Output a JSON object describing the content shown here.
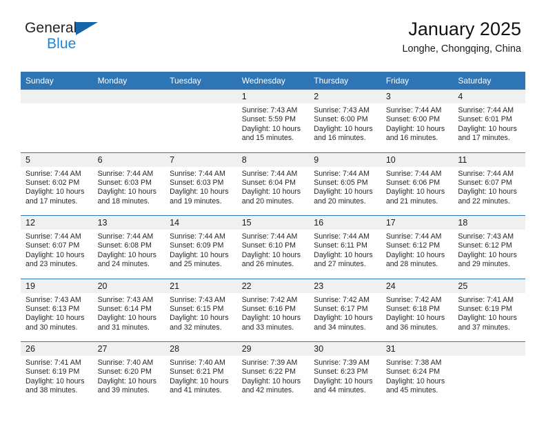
{
  "brand": {
    "line1": "General",
    "line2": "Blue",
    "triangle_color": "#1565a8",
    "blue_text_color": "#1a87d8"
  },
  "header": {
    "title": "January 2025",
    "subtitle": "Longhe, Chongqing, China"
  },
  "theme": {
    "header_blue": "#2e75b6",
    "daynum_band": "#f0f0f0",
    "cell_bg": "#ffffff",
    "text": "#262626"
  },
  "weekdays": [
    "Sunday",
    "Monday",
    "Tuesday",
    "Wednesday",
    "Thursday",
    "Friday",
    "Saturday"
  ],
  "weeks": [
    {
      "days": [
        {
          "num": "",
          "lines": []
        },
        {
          "num": "",
          "lines": []
        },
        {
          "num": "",
          "lines": []
        },
        {
          "num": "1",
          "lines": [
            "Sunrise: 7:43 AM",
            "Sunset: 5:59 PM",
            "Daylight: 10 hours",
            "and 15 minutes."
          ]
        },
        {
          "num": "2",
          "lines": [
            "Sunrise: 7:43 AM",
            "Sunset: 6:00 PM",
            "Daylight: 10 hours",
            "and 16 minutes."
          ]
        },
        {
          "num": "3",
          "lines": [
            "Sunrise: 7:44 AM",
            "Sunset: 6:00 PM",
            "Daylight: 10 hours",
            "and 16 minutes."
          ]
        },
        {
          "num": "4",
          "lines": [
            "Sunrise: 7:44 AM",
            "Sunset: 6:01 PM",
            "Daylight: 10 hours",
            "and 17 minutes."
          ]
        }
      ]
    },
    {
      "days": [
        {
          "num": "5",
          "lines": [
            "Sunrise: 7:44 AM",
            "Sunset: 6:02 PM",
            "Daylight: 10 hours",
            "and 17 minutes."
          ]
        },
        {
          "num": "6",
          "lines": [
            "Sunrise: 7:44 AM",
            "Sunset: 6:03 PM",
            "Daylight: 10 hours",
            "and 18 minutes."
          ]
        },
        {
          "num": "7",
          "lines": [
            "Sunrise: 7:44 AM",
            "Sunset: 6:03 PM",
            "Daylight: 10 hours",
            "and 19 minutes."
          ]
        },
        {
          "num": "8",
          "lines": [
            "Sunrise: 7:44 AM",
            "Sunset: 6:04 PM",
            "Daylight: 10 hours",
            "and 20 minutes."
          ]
        },
        {
          "num": "9",
          "lines": [
            "Sunrise: 7:44 AM",
            "Sunset: 6:05 PM",
            "Daylight: 10 hours",
            "and 20 minutes."
          ]
        },
        {
          "num": "10",
          "lines": [
            "Sunrise: 7:44 AM",
            "Sunset: 6:06 PM",
            "Daylight: 10 hours",
            "and 21 minutes."
          ]
        },
        {
          "num": "11",
          "lines": [
            "Sunrise: 7:44 AM",
            "Sunset: 6:07 PM",
            "Daylight: 10 hours",
            "and 22 minutes."
          ]
        }
      ]
    },
    {
      "days": [
        {
          "num": "12",
          "lines": [
            "Sunrise: 7:44 AM",
            "Sunset: 6:07 PM",
            "Daylight: 10 hours",
            "and 23 minutes."
          ]
        },
        {
          "num": "13",
          "lines": [
            "Sunrise: 7:44 AM",
            "Sunset: 6:08 PM",
            "Daylight: 10 hours",
            "and 24 minutes."
          ]
        },
        {
          "num": "14",
          "lines": [
            "Sunrise: 7:44 AM",
            "Sunset: 6:09 PM",
            "Daylight: 10 hours",
            "and 25 minutes."
          ]
        },
        {
          "num": "15",
          "lines": [
            "Sunrise: 7:44 AM",
            "Sunset: 6:10 PM",
            "Daylight: 10 hours",
            "and 26 minutes."
          ]
        },
        {
          "num": "16",
          "lines": [
            "Sunrise: 7:44 AM",
            "Sunset: 6:11 PM",
            "Daylight: 10 hours",
            "and 27 minutes."
          ]
        },
        {
          "num": "17",
          "lines": [
            "Sunrise: 7:44 AM",
            "Sunset: 6:12 PM",
            "Daylight: 10 hours",
            "and 28 minutes."
          ]
        },
        {
          "num": "18",
          "lines": [
            "Sunrise: 7:43 AM",
            "Sunset: 6:12 PM",
            "Daylight: 10 hours",
            "and 29 minutes."
          ]
        }
      ]
    },
    {
      "days": [
        {
          "num": "19",
          "lines": [
            "Sunrise: 7:43 AM",
            "Sunset: 6:13 PM",
            "Daylight: 10 hours",
            "and 30 minutes."
          ]
        },
        {
          "num": "20",
          "lines": [
            "Sunrise: 7:43 AM",
            "Sunset: 6:14 PM",
            "Daylight: 10 hours",
            "and 31 minutes."
          ]
        },
        {
          "num": "21",
          "lines": [
            "Sunrise: 7:43 AM",
            "Sunset: 6:15 PM",
            "Daylight: 10 hours",
            "and 32 minutes."
          ]
        },
        {
          "num": "22",
          "lines": [
            "Sunrise: 7:42 AM",
            "Sunset: 6:16 PM",
            "Daylight: 10 hours",
            "and 33 minutes."
          ]
        },
        {
          "num": "23",
          "lines": [
            "Sunrise: 7:42 AM",
            "Sunset: 6:17 PM",
            "Daylight: 10 hours",
            "and 34 minutes."
          ]
        },
        {
          "num": "24",
          "lines": [
            "Sunrise: 7:42 AM",
            "Sunset: 6:18 PM",
            "Daylight: 10 hours",
            "and 36 minutes."
          ]
        },
        {
          "num": "25",
          "lines": [
            "Sunrise: 7:41 AM",
            "Sunset: 6:19 PM",
            "Daylight: 10 hours",
            "and 37 minutes."
          ]
        }
      ]
    },
    {
      "days": [
        {
          "num": "26",
          "lines": [
            "Sunrise: 7:41 AM",
            "Sunset: 6:19 PM",
            "Daylight: 10 hours",
            "and 38 minutes."
          ]
        },
        {
          "num": "27",
          "lines": [
            "Sunrise: 7:40 AM",
            "Sunset: 6:20 PM",
            "Daylight: 10 hours",
            "and 39 minutes."
          ]
        },
        {
          "num": "28",
          "lines": [
            "Sunrise: 7:40 AM",
            "Sunset: 6:21 PM",
            "Daylight: 10 hours",
            "and 41 minutes."
          ]
        },
        {
          "num": "29",
          "lines": [
            "Sunrise: 7:39 AM",
            "Sunset: 6:22 PM",
            "Daylight: 10 hours",
            "and 42 minutes."
          ]
        },
        {
          "num": "30",
          "lines": [
            "Sunrise: 7:39 AM",
            "Sunset: 6:23 PM",
            "Daylight: 10 hours",
            "and 44 minutes."
          ]
        },
        {
          "num": "31",
          "lines": [
            "Sunrise: 7:38 AM",
            "Sunset: 6:24 PM",
            "Daylight: 10 hours",
            "and 45 minutes."
          ]
        },
        {
          "num": "",
          "lines": []
        }
      ]
    }
  ]
}
